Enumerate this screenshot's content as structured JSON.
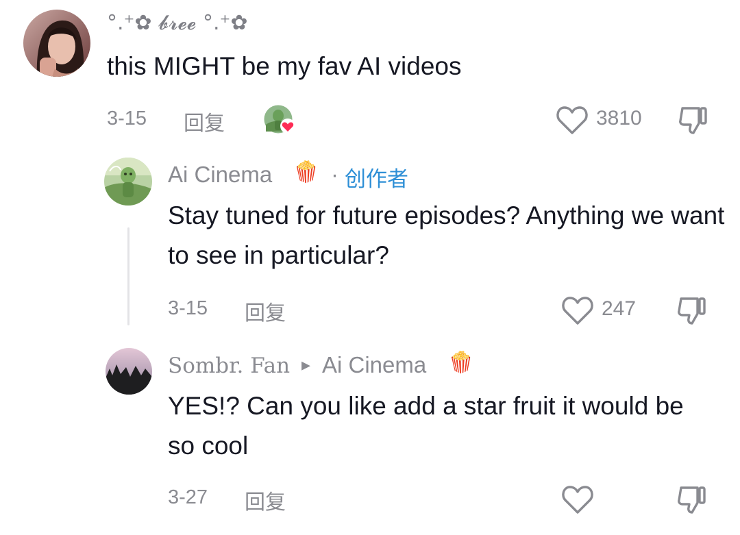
{
  "comments": [
    {
      "username": "°.⁺✿ 𝓫𝓻𝓮𝓮 °.⁺✿",
      "text": "this MIGHT be my fav AI videos",
      "date": "3-15",
      "reply_label": "回复",
      "likes": "3810"
    },
    {
      "username": "Ai Cinema",
      "username_emoji": "🍿",
      "separator": "·",
      "badge": "创作者",
      "text": "Stay tuned for future episodes? Anything we want to see in particular?",
      "date": "3-15",
      "reply_label": "回复",
      "likes": "247"
    },
    {
      "username": "Sombr. Fan",
      "reply_arrow": "▸",
      "reply_to": "Ai Cinema",
      "reply_to_emoji": "🍿",
      "text": "YES!? Can you like add a star fruit it would be so cool",
      "date": "3-27",
      "reply_label": "回复",
      "likes": ""
    }
  ],
  "colors": {
    "text_primary": "#161823",
    "text_secondary": "#8a8b91",
    "creator_badge": "#2e8fd6",
    "liked_by_creator_heart": "#fe2c55"
  },
  "icons": {
    "like": "heart-outline-icon",
    "dislike": "thumbs-down-icon",
    "creator_like": "creator-liked-badge-icon"
  }
}
